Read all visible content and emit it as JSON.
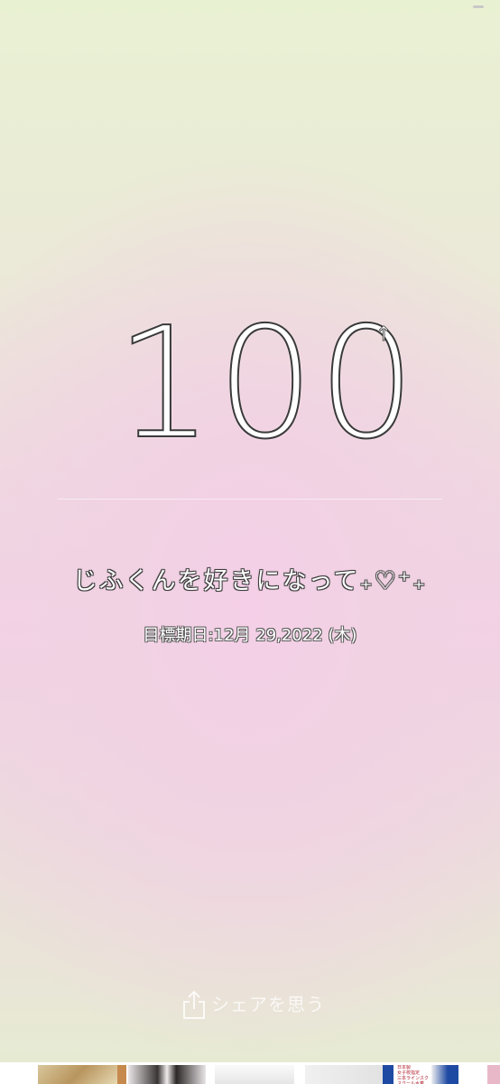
{
  "counter": {
    "value": "100",
    "direction_icon": "up-arrow-icon"
  },
  "goal": {
    "title": "じふくんを好きになって₊♡⁺₊",
    "target_date_label": "目標期日:12月 29,2022 (木)"
  },
  "share": {
    "label": "シェアを思う",
    "icon": "share-icon"
  },
  "ads": {
    "items": [
      {
        "name": "food-ad",
        "color": "#c9b489"
      },
      {
        "name": "bedroom-ad",
        "color": "#c78a4e"
      },
      {
        "name": "people-ad",
        "color": "#e8e4e4"
      },
      {
        "name": "table-ad",
        "color": "#f2f2f2"
      },
      {
        "name": "person-ad",
        "color": "#ededed"
      },
      {
        "name": "swimsuit-ad",
        "color": "#1f4aa3"
      },
      {
        "name": "text-ad",
        "color": "#ffffff",
        "text": "日本製\n女子校指定\n三本ラインスク\nスクール水着"
      }
    ]
  },
  "colors": {
    "text_fill": "#ffffff",
    "text_outline": "#3c3c3c",
    "background_top": "#e9f1d3",
    "background_center": "#f2d0e5"
  }
}
